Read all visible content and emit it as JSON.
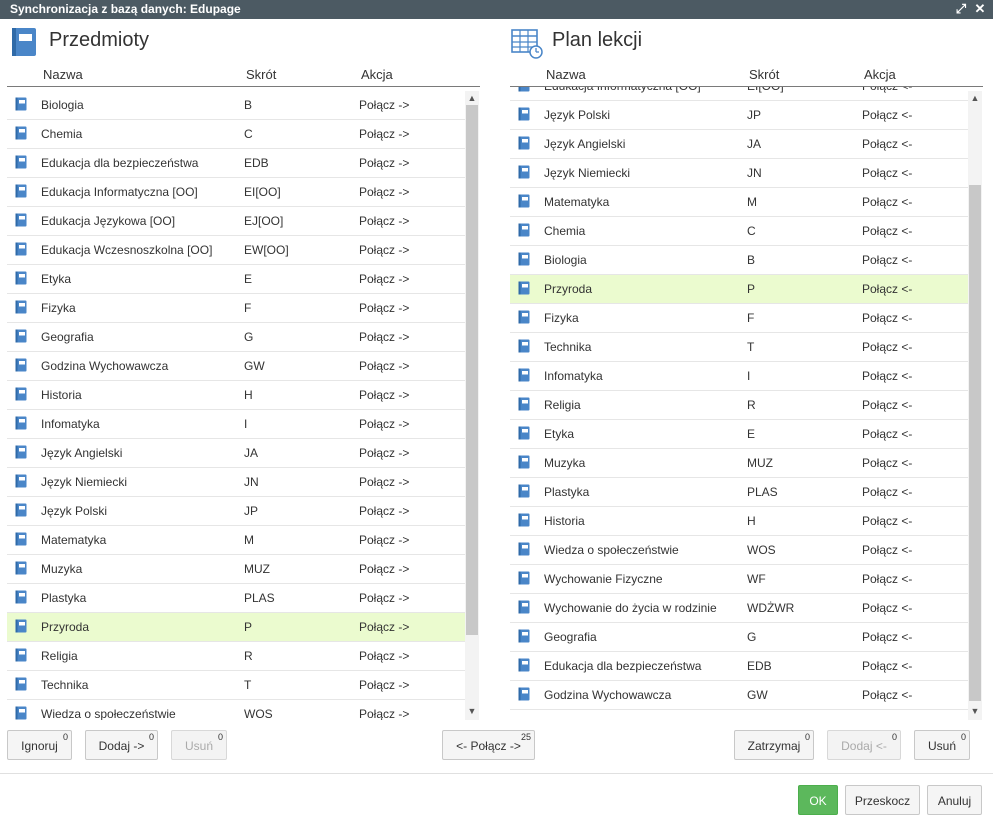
{
  "window": {
    "title": "Synchronizacja z bazą danych: Edupage"
  },
  "left": {
    "title": "Przedmioty",
    "headers": {
      "name": "Nazwa",
      "abbr": "Skrót",
      "action": "Akcja"
    },
    "rows": [
      {
        "name": "Biologia",
        "abbr": "B",
        "action": "Połącz ->"
      },
      {
        "name": "Chemia",
        "abbr": "C",
        "action": "Połącz ->"
      },
      {
        "name": "Edukacja dla bezpieczeństwa",
        "abbr": "EDB",
        "action": "Połącz ->"
      },
      {
        "name": "Edukacja Informatyczna [OO]",
        "abbr": "EI[OO]",
        "action": "Połącz ->"
      },
      {
        "name": "Edukacja Językowa [OO]",
        "abbr": "EJ[OO]",
        "action": "Połącz ->"
      },
      {
        "name": "Edukacja Wczesnoszkolna [OO]",
        "abbr": "EW[OO]",
        "action": "Połącz ->"
      },
      {
        "name": "Etyka",
        "abbr": "E",
        "action": "Połącz ->"
      },
      {
        "name": "Fizyka",
        "abbr": "F",
        "action": "Połącz ->"
      },
      {
        "name": "Geografia",
        "abbr": "G",
        "action": "Połącz ->"
      },
      {
        "name": "Godzina Wychowawcza",
        "abbr": "GW",
        "action": "Połącz ->"
      },
      {
        "name": "Historia",
        "abbr": "H",
        "action": "Połącz ->"
      },
      {
        "name": "Infomatyka",
        "abbr": "I",
        "action": "Połącz ->"
      },
      {
        "name": "Język Angielski",
        "abbr": "JA",
        "action": "Połącz ->"
      },
      {
        "name": "Język Niemiecki",
        "abbr": "JN",
        "action": "Połącz ->"
      },
      {
        "name": "Język Polski",
        "abbr": "JP",
        "action": "Połącz ->"
      },
      {
        "name": "Matematyka",
        "abbr": "M",
        "action": "Połącz ->"
      },
      {
        "name": "Muzyka",
        "abbr": "MUZ",
        "action": "Połącz ->"
      },
      {
        "name": "Plastyka",
        "abbr": "PLAS",
        "action": "Połącz ->"
      },
      {
        "name": "Przyroda",
        "abbr": "P",
        "action": "Połącz ->",
        "selected": true
      },
      {
        "name": "Religia",
        "abbr": "R",
        "action": "Połącz ->"
      },
      {
        "name": "Technika",
        "abbr": "T",
        "action": "Połącz ->"
      },
      {
        "name": "Wiedza o społeczeństwie",
        "abbr": "WOS",
        "action": "Połącz ->"
      }
    ]
  },
  "right": {
    "title": "Plan lekcji",
    "headers": {
      "name": "Nazwa",
      "abbr": "Skrót",
      "action": "Akcja"
    },
    "rows": [
      {
        "name": "Edukacja Informatyczna [OO]",
        "abbr": "EI[OO]",
        "action": "Połącz <-"
      },
      {
        "name": "Język Polski",
        "abbr": "JP",
        "action": "Połącz <-"
      },
      {
        "name": "Język Angielski",
        "abbr": "JA",
        "action": "Połącz <-"
      },
      {
        "name": "Język Niemiecki",
        "abbr": "JN",
        "action": "Połącz <-"
      },
      {
        "name": "Matematyka",
        "abbr": "M",
        "action": "Połącz <-"
      },
      {
        "name": "Chemia",
        "abbr": "C",
        "action": "Połącz <-"
      },
      {
        "name": "Biologia",
        "abbr": "B",
        "action": "Połącz <-"
      },
      {
        "name": "Przyroda",
        "abbr": "P",
        "action": "Połącz <-",
        "selected": true
      },
      {
        "name": "Fizyka",
        "abbr": "F",
        "action": "Połącz <-"
      },
      {
        "name": "Technika",
        "abbr": "T",
        "action": "Połącz <-"
      },
      {
        "name": "Infomatyka",
        "abbr": "I",
        "action": "Połącz <-"
      },
      {
        "name": "Religia",
        "abbr": "R",
        "action": "Połącz <-"
      },
      {
        "name": "Etyka",
        "abbr": "E",
        "action": "Połącz <-"
      },
      {
        "name": "Muzyka",
        "abbr": "MUZ",
        "action": "Połącz <-"
      },
      {
        "name": "Plastyka",
        "abbr": "PLAS",
        "action": "Połącz <-"
      },
      {
        "name": "Historia",
        "abbr": "H",
        "action": "Połącz <-"
      },
      {
        "name": "Wiedza o społeczeństwie",
        "abbr": "WOS",
        "action": "Połącz <-"
      },
      {
        "name": "Wychowanie Fizyczne",
        "abbr": "WF",
        "action": "Połącz <-"
      },
      {
        "name": "Wychowanie do życia w rodzinie",
        "abbr": "WDŻWR",
        "action": "Połącz <-"
      },
      {
        "name": "Geografia",
        "abbr": "G",
        "action": "Połącz <-"
      },
      {
        "name": "Edukacja dla bezpieczeństwa",
        "abbr": "EDB",
        "action": "Połącz <-"
      },
      {
        "name": "Godzina Wychowawcza",
        "abbr": "GW",
        "action": "Połącz <-"
      }
    ]
  },
  "buttons": {
    "ignore": {
      "label": "Ignoruj",
      "count": "0"
    },
    "add_right": {
      "label": "Dodaj ->",
      "count": "0"
    },
    "remove_left": {
      "label": "Usuń",
      "count": "0"
    },
    "connect": {
      "label": "<- Połącz ->",
      "count": "25"
    },
    "hold": {
      "label": "Zatrzymaj",
      "count": "0"
    },
    "add_left": {
      "label": "Dodaj <-",
      "count": "0"
    },
    "remove_right": {
      "label": "Usuń",
      "count": "0"
    },
    "ok": {
      "label": "OK"
    },
    "skip": {
      "label": "Przeskocz"
    },
    "cancel": {
      "label": "Anuluj"
    }
  },
  "colors": {
    "titlebar": "#4c5a63",
    "selected_row": "#ebfbcf",
    "ok_button": "#5cb85c",
    "book_icon": "#4a86c8"
  }
}
